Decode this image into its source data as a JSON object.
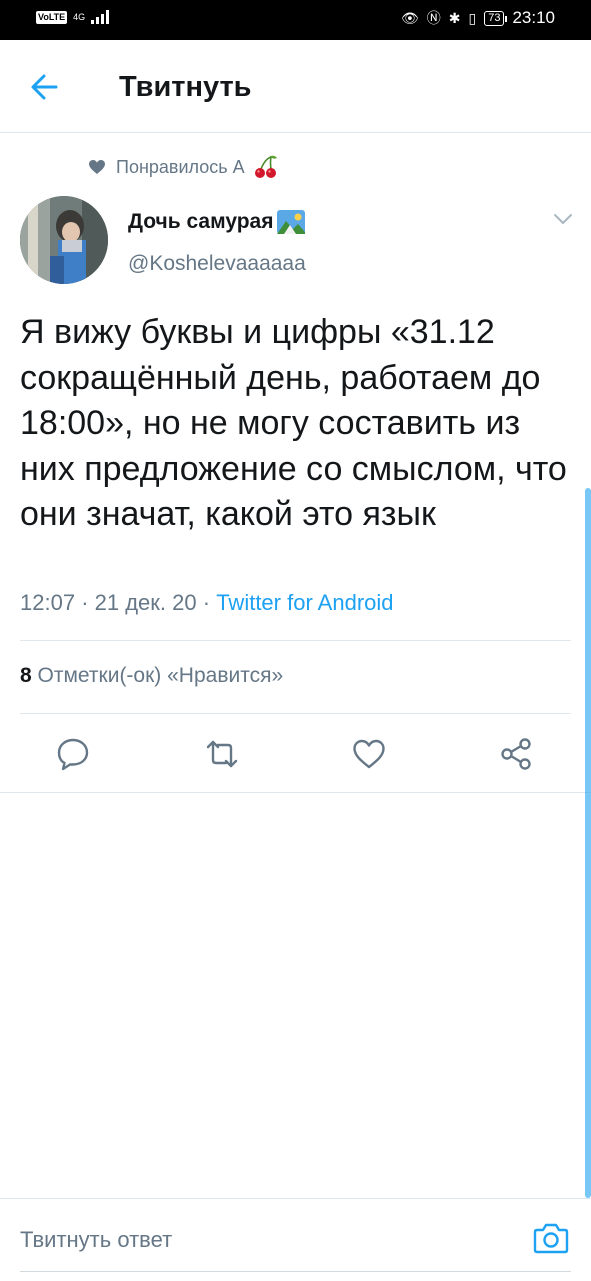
{
  "status_bar": {
    "volte": "VoLTE",
    "network": "4G",
    "battery": "73",
    "time": "23:10"
  },
  "header": {
    "title": "Твитнуть"
  },
  "social_context": {
    "text": "Понравилось А"
  },
  "author": {
    "name": "Дочь самурая",
    "handle": "@Koshelevaaaaaa"
  },
  "tweet": {
    "text": "Я вижу буквы и цифры «31.12 сокращённый день, работаем до 18:00», но не могу составить из них предложение со смыслом, что они значат, какой это язык",
    "time": "12:07",
    "date": "21 дек. 20",
    "source": "Twitter for Android"
  },
  "stats": {
    "likes_count": "8",
    "likes_label": "Отметки(-ок) «Нравится»"
  },
  "reply_bar": {
    "placeholder": "Твитнуть ответ"
  },
  "colors": {
    "accent": "#1da1f2",
    "secondary_text": "#657786",
    "divider": "#e1e8ed"
  },
  "icons": {
    "back": "arrow-left-icon",
    "reply": "comment-icon",
    "retweet": "retweet-icon",
    "like": "heart-icon",
    "share": "share-icon",
    "camera": "camera-icon",
    "more": "chevron-down-icon"
  }
}
